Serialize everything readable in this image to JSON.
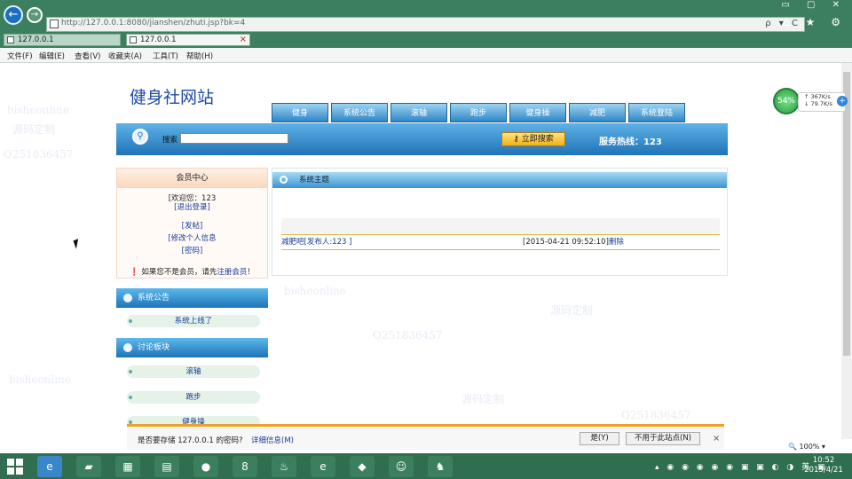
{
  "browser": {
    "address_url": "http://127.0.0.1:8080/jianshen/zhuti.jsp?bk=4",
    "tabs": [
      {
        "label": "127.0.0.1"
      },
      {
        "label": "127.0.0.1",
        "close": "×"
      }
    ],
    "menu": [
      "文件(F)",
      "编辑(E)",
      "查看(V)",
      "收藏夹(A)",
      "工具(T)",
      "帮助(H)"
    ],
    "window_controls": "▭ ▢ ✕",
    "address_actions": "ρ ▾ C",
    "chrome_icons": "⌂ ★ ⚙"
  },
  "site": {
    "title": "健身社网站",
    "nav": [
      "健身",
      "系统公告",
      "滚轴",
      "跑步",
      "健身操",
      "减肥",
      "系统登陆"
    ],
    "search_label": "搜索",
    "search_button": "立即搜索",
    "hotline": "服务热线：123"
  },
  "member": {
    "header": "会员中心",
    "welcome": "[欢迎您：123",
    "logout": "[退出登录]",
    "post": "[发帖]",
    "edit_info": "[修改个人信息",
    "password": "[密码]",
    "register_prefix": "如果您不是会员，请先",
    "register_link": "注册会员",
    "register_suffix": "！"
  },
  "announce": {
    "header": "系统公告",
    "items": [
      "系统上线了"
    ]
  },
  "forum": {
    "header": "讨论板块",
    "items": [
      "滚轴",
      "跑步",
      "健身操"
    ]
  },
  "topics": {
    "header": "系统主题",
    "rows": [
      {
        "title": "减肥吧[发布人:123 ]",
        "date": "[2015-04-21 09:52:10]",
        "action": "删除"
      }
    ]
  },
  "notification": {
    "message": "是否要存储 127.0.0.1 的密码?",
    "more": "详细信息(M)",
    "yes": "是(Y)",
    "no": "不用于此站点(N)",
    "close": "×"
  },
  "network_widget": {
    "percent": "54%",
    "up": "367K/s",
    "down": "79.7K/s"
  },
  "zoom": "100%",
  "taskbar": {
    "time": "10:52",
    "date": "2015/4/21"
  },
  "watermarks": [
    "bisheonline",
    "源码定制",
    "Q2518364​57"
  ]
}
